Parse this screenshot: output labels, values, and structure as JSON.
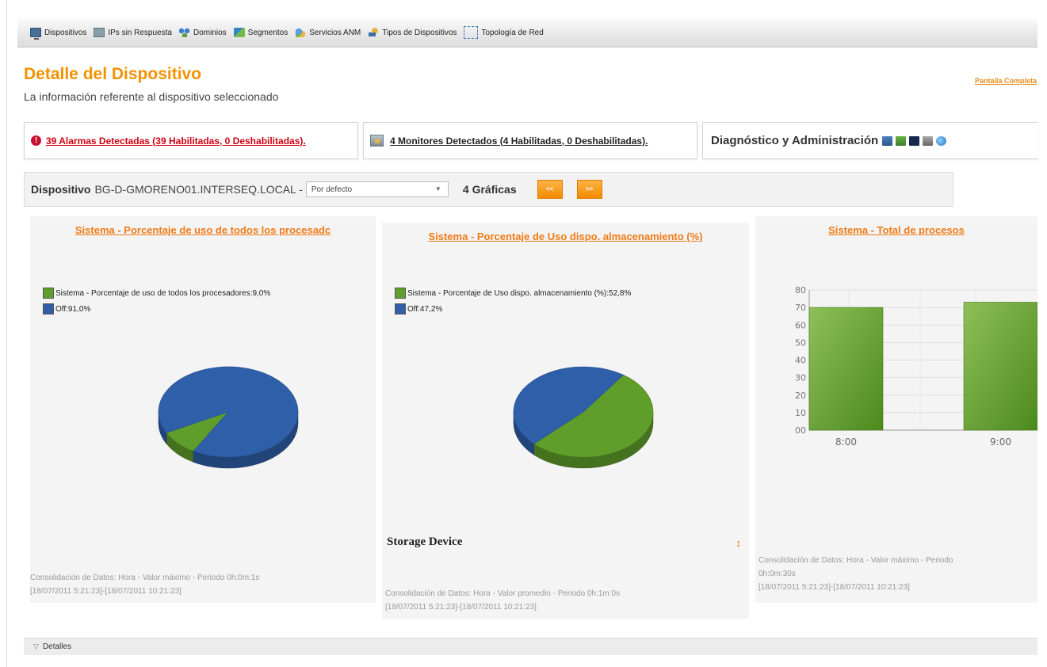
{
  "toolbar": {
    "items": [
      {
        "label": "Dispositivos",
        "icon": "monitor-icon"
      },
      {
        "label": "IPs sin Respuesta",
        "icon": "ip-icon"
      },
      {
        "label": "Dominios",
        "icon": "domain-icon"
      },
      {
        "label": "Segmentos",
        "icon": "segment-icon"
      },
      {
        "label": "Servicios ANM",
        "icon": "services-icon"
      },
      {
        "label": "Tipos de Dispositivos",
        "icon": "device-types-icon"
      },
      {
        "label": "Topología de Red",
        "icon": "topology-icon"
      }
    ]
  },
  "header": {
    "title": "Detalle del Dispositivo",
    "subtitle": "La información referente al dispositivo seleccionado",
    "fullscreen_link": "Pantalla Completa"
  },
  "alarms": {
    "text": "39 Alarmas Detectadas (39 Habilitadas, 0 Deshabilitadas).",
    "icon_glyph": "!"
  },
  "monitors": {
    "text": "4 Monitores Detectados (4 Habilitadas, 0 Deshabilitadas)."
  },
  "diagnostics": {
    "label": "Diagnóstico y Administración"
  },
  "device_bar": {
    "label": "Dispositivo",
    "device_name": "BG-D-GMORENO01.INTERSEQ.LOCAL -",
    "select_value": "Por defecto",
    "chart_count": "4 Gráficas",
    "prev_label": "<<",
    "next_label": ">>"
  },
  "colors": {
    "accent": "#f39200",
    "link_orange": "#f07b16",
    "alarm_red": "#d00012",
    "series_green": "#5f9e2a",
    "series_blue": "#2e5fa8"
  },
  "chart_data": [
    {
      "type": "pie",
      "title": "Sistema - Porcentaje de uso de todos los procesadc",
      "legend": [
        "Sistema - Porcentaje de uso de todos los procesadores:9,0%",
        "Off:91,0%"
      ],
      "slices": [
        {
          "label": "Sistema - Porcentaje de uso de todos los procesadores",
          "value": 9.0,
          "color": "#5f9e2a"
        },
        {
          "label": "Off",
          "value": 91.0,
          "color": "#2e5fa8"
        }
      ],
      "consolidation_line1": "Consolidación de Datos: Hora - Valor máximo - Periodo 0h:0m:1s",
      "consolidation_line2": "[18/07/2011 5:21:23]-[18/07/2011 10:21:23]"
    },
    {
      "type": "pie",
      "title": "Sistema - Porcentaje de Uso dispo. almacenamiento (%)",
      "legend": [
        "Sistema - Porcentaje de Uso dispo. almacenamiento (%):52,8%",
        "Off:47,2%"
      ],
      "slices": [
        {
          "label": "Sistema - Porcentaje de Uso dispo. almacenamiento (%)",
          "value": 52.8,
          "color": "#5f9e2a"
        },
        {
          "label": "Off",
          "value": 47.2,
          "color": "#2e5fa8"
        }
      ],
      "footer_label": "Storage Device",
      "footer_icon_glyph": "↕",
      "consolidation_line1": "Consolidación de Datos: Hora - Valor promedio - Periodo 0h:1m:0s",
      "consolidation_line2": "[18/07/2011 5:21:23]-[18/07/2011 10:21:23]"
    },
    {
      "type": "bar",
      "title": "Sistema - Total de procesos",
      "categories": [
        "8:00",
        "9:00"
      ],
      "values": [
        70,
        73
      ],
      "yticks": [
        "00",
        "10",
        "20",
        "30",
        "40",
        "50",
        "60",
        "70",
        "80"
      ],
      "ylim": [
        0,
        80
      ],
      "grid": true,
      "consolidation_line1": "Consolidación de Datos: Hora - Valor máximo - Periodo",
      "consolidation_line2": "0h:0m:30s",
      "consolidation_line3": "[18/07/2011 5:21:23]-[18/07/2011 10:21:23]"
    }
  ],
  "details": {
    "label": "Detalles",
    "toggle_glyph": "▽"
  }
}
